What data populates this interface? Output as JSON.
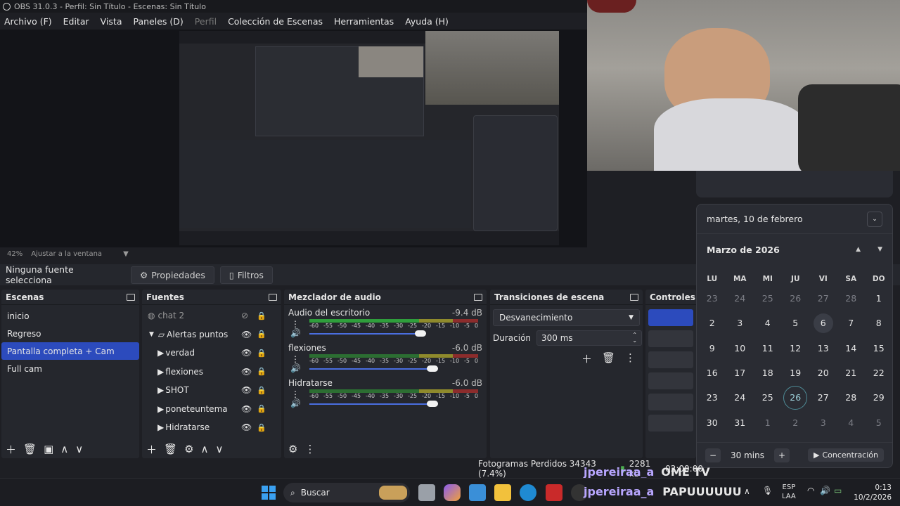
{
  "window": {
    "title": "OBS 31.0.3 - Perfil: Sin Título - Escenas: Sin Título"
  },
  "menu": [
    "Archivo (F)",
    "Editar",
    "Vista",
    "Paneles (D)",
    "Perfil",
    "Colección de Escenas",
    "Herramientas",
    "Ayuda (H)"
  ],
  "zoom": {
    "percent": "42%",
    "fit_label": "Ajustar a la ventana"
  },
  "source_bar": {
    "no_source": "Ninguna fuente selecciona",
    "properties": "Propiedades",
    "filters": "Filtros"
  },
  "scenes": {
    "title": "Escenas",
    "items": [
      "inicio",
      "Regreso",
      "Pantalla completa + Cam",
      "Full cam"
    ],
    "selected_index": 2
  },
  "sources": {
    "title": "Fuentes",
    "items": [
      {
        "name": "chat 2",
        "kind": "browser"
      },
      {
        "name": "Alertas puntos",
        "kind": "group"
      },
      {
        "name": "verdad",
        "kind": "media"
      },
      {
        "name": "flexiones",
        "kind": "media"
      },
      {
        "name": "SHOT",
        "kind": "media"
      },
      {
        "name": "poneteuntema",
        "kind": "media"
      },
      {
        "name": "Hidratarse",
        "kind": "media"
      }
    ]
  },
  "mixer": {
    "title": "Mezclador de audio",
    "ticks": [
      "-60",
      "-55",
      "-50",
      "-45",
      "-40",
      "-35",
      "-30",
      "-25",
      "-20",
      "-15",
      "-10",
      "-5",
      "0"
    ],
    "channels": [
      {
        "name": "Audio del escritorio",
        "db": "-9.4 dB",
        "level": 0.28,
        "volume": 0.66
      },
      {
        "name": "flexiones",
        "db": "-6.0 dB",
        "level": 0,
        "volume": 0.73
      },
      {
        "name": "Hidratarse",
        "db": "-6.0 dB",
        "level": 0,
        "volume": 0.73
      }
    ]
  },
  "transitions": {
    "title": "Transiciones de escena",
    "selected": "Desvanecimiento",
    "duration_label": "Duración",
    "duration_value": "300 ms"
  },
  "controls": {
    "title": "Controles"
  },
  "status": {
    "dropped": "Fotogramas Perdidos 34343 (7.4%)",
    "kbps": "2281 kb",
    "time": "02:00:00"
  },
  "overlay": {
    "chat_user": "jpereiraa_a",
    "brand": "OME TV",
    "chat_msg": "PAPUUUUUU"
  },
  "calendar": {
    "date_header": "martes, 10 de febrero",
    "month": "Marzo de 2026",
    "weekdays": [
      "LU",
      "MA",
      "MI",
      "JU",
      "VI",
      "SA",
      "DO"
    ],
    "weeks": [
      [
        "23",
        "24",
        "25",
        "26",
        "27",
        "28",
        "1"
      ],
      [
        "2",
        "3",
        "4",
        "5",
        "6",
        "7",
        "8"
      ],
      [
        "9",
        "10",
        "11",
        "12",
        "13",
        "14",
        "15"
      ],
      [
        "16",
        "17",
        "18",
        "19",
        "20",
        "21",
        "22"
      ],
      [
        "23",
        "24",
        "25",
        "26",
        "27",
        "28",
        "29"
      ],
      [
        "30",
        "31",
        "1",
        "2",
        "3",
        "4",
        "5"
      ]
    ],
    "focus_minutes": "30 mins",
    "focus_label": "Concentración"
  },
  "taskbar": {
    "search": "Buscar",
    "lang": "ESP",
    "layout": "LAA",
    "time": "0:13",
    "date": "10/2/2026"
  },
  "colors": {
    "accent": "#2c4bbd",
    "bg": "#1e1f24",
    "dock": "#25272d"
  }
}
